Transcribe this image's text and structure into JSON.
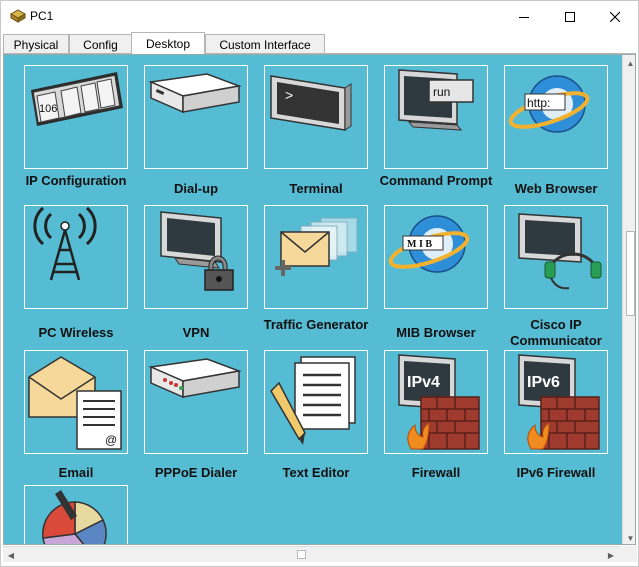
{
  "window": {
    "title": "PC1",
    "icons": {
      "app": "router-icon",
      "minimize": "minimize-icon",
      "maximize": "maximize-icon",
      "close": "close-icon"
    }
  },
  "tabs": [
    {
      "label": "Physical",
      "active": false
    },
    {
      "label": "Config",
      "active": false
    },
    {
      "label": "Desktop",
      "active": true
    },
    {
      "label": "Custom Interface",
      "active": false
    }
  ],
  "colors": {
    "desktop_bg": "#55bcd3",
    "tile_border": "#ffffff"
  },
  "apps": [
    {
      "label": "IP Configuration",
      "icon": "ip-configuration-icon",
      "icon_text": "106"
    },
    {
      "label": "Dial-up",
      "icon": "modem-icon"
    },
    {
      "label": "Terminal",
      "icon": "terminal-icon",
      "icon_text": ">"
    },
    {
      "label": "Command Prompt",
      "icon": "command-prompt-icon",
      "icon_text": "run"
    },
    {
      "label": "Web Browser",
      "icon": "web-browser-icon",
      "icon_text": "http:"
    },
    {
      "label": "PC Wireless",
      "icon": "wireless-tower-icon"
    },
    {
      "label": "VPN",
      "icon": "vpn-lock-icon"
    },
    {
      "label": "Traffic Generator",
      "icon": "traffic-generator-icon"
    },
    {
      "label": "MIB Browser",
      "icon": "mib-browser-icon",
      "icon_text": "M I B"
    },
    {
      "label": "Cisco IP Communicator",
      "icon": "headset-icon"
    },
    {
      "label": "Email",
      "icon": "email-icon",
      "icon_text": "@"
    },
    {
      "label": "PPPoE Dialer",
      "icon": "pppoe-modem-icon"
    },
    {
      "label": "Text Editor",
      "icon": "text-editor-icon"
    },
    {
      "label": "Firewall",
      "icon": "firewall-icon",
      "icon_text": "IPv4"
    },
    {
      "label": "IPv6 Firewall",
      "icon": "ipv6-firewall-icon",
      "icon_text": "IPv6"
    },
    {
      "label": "",
      "icon": "pie-chart-icon"
    }
  ]
}
